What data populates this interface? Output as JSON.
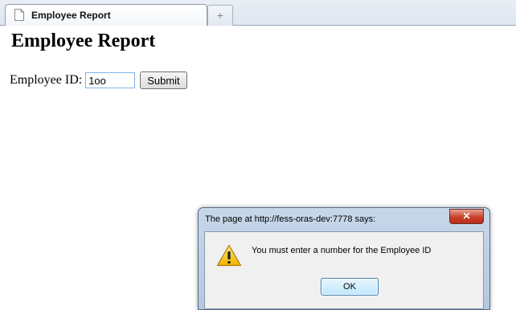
{
  "browser": {
    "tab_title": "Employee Report",
    "new_tab_glyph": "+",
    "tab_icon": "page-icon",
    "new_tab_icon": "plus-icon"
  },
  "page": {
    "title": "Employee Report",
    "form": {
      "employee_id_label": "Employee ID:",
      "employee_id_value": "1oo",
      "submit_label": "Submit"
    }
  },
  "dialog": {
    "title": "The page at http://fess-oras-dev:7778 says:",
    "close_label": "✕",
    "icon": "warning-icon",
    "message": "You must enter a number for the Employee ID",
    "ok_label": "OK"
  },
  "colors": {
    "warning_yellow": "#f5c518",
    "close_red": "#c8402b",
    "ok_blue": "#3c7fb1"
  }
}
